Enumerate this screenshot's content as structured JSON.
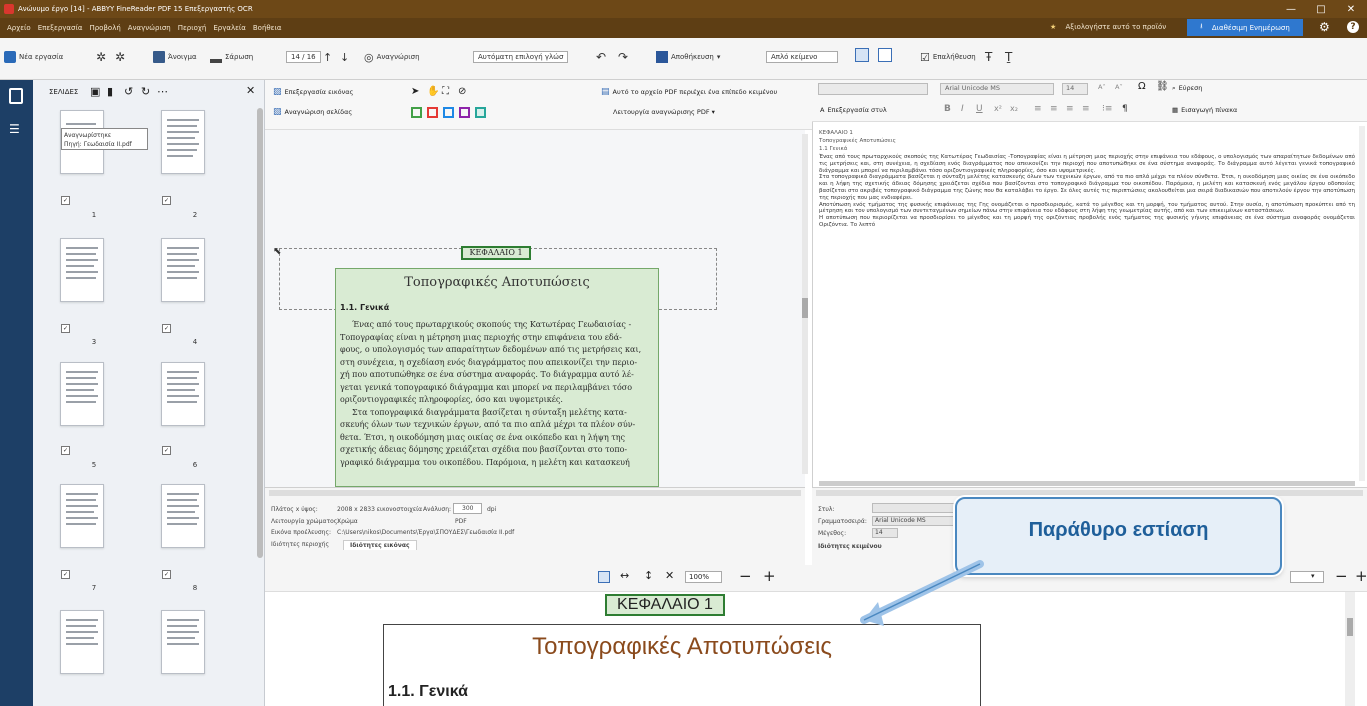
{
  "window": {
    "title": "Ανώνυμο έργο [14] - ABBYY FineReader PDF 15 Επεξεργαστής OCR"
  },
  "menu": [
    "Αρχείο",
    "Επεξεργασία",
    "Προβολή",
    "Αναγνώριση",
    "Περιοχή",
    "Εργαλεία",
    "Βοήθεια"
  ],
  "header_right": {
    "rate": "Αξιολογήστε αυτό το προϊόν",
    "update": "Διαθέσιμη Ενημέρωση"
  },
  "toolbar": {
    "new_task": "Νέα εργασία",
    "open": "Άνοιγμα",
    "save": "Σάρωση",
    "page_counter": "14 / 16",
    "recognize": "Αναγνώριση",
    "lang_select": "Αυτόματη επιλογή γλώσ",
    "save_as": "Αποθήκευση",
    "format_select": "Απλό κείμενο",
    "verify": "Επαλήθευση"
  },
  "thumbs": {
    "title": "ΣΕΛΙΔΕΣ",
    "tooltip_line1": "Αναγνωρίστηκε",
    "tooltip_line2": "Πηγή: Γεωδαισία II.pdf",
    "pages": [
      "1",
      "2",
      "3",
      "4",
      "5",
      "6",
      "7",
      "8"
    ]
  },
  "image_toolbar": {
    "edit_image": "Επεξεργασία εικόνας",
    "recognize_page": "Αναγνώριση σελίδας",
    "pdf_layer": "Αυτό το αρχείο PDF περιέχει ένα επίπεδο κειμένου",
    "pdf_mode": "Λειτουργία αναγνώρισης PDF ▾"
  },
  "pdf": {
    "chapter": "ΚΕΦΑΛΑΙΟ 1",
    "title": "Τοπογραφικές Αποτυπώσεις",
    "section": "1.1. Γενικά",
    "lines": [
      "Ένας από τους πρωταρχικούς σκοπούς της Κατωτέρας Γεωδαισίας -",
      "Τοπογραφίας είναι η μέτρηση μιας περιοχής στην επιφάνεια του εδά-",
      "φους, ο υπολογισμός των απαραίτητων δεδομένων από τις μετρήσεις και,",
      "στη συνέχεια, η σχεδίαση ενός διαγράμματος που απεικονίζει την περιο-",
      "χή που αποτυπώθηκε σε ένα σύστημα αναφοράς. Το διάγραμμα αυτό λέ-",
      "γεται γενικά τοπογραφικό διάγραμμα και μπορεί να περιλαμβάνει τόσο",
      "οριζοντιογραφικές πληροφορίες, όσο και υψομετρικές.",
      "Στα τοπογραφικά διαγράμματα βασίζεται η σύνταξη μελέτης κατα-",
      "σκευής όλων των τεχνικών έργων, από τα πιο απλά μέχρι τα πλέον σύν-",
      "θετα. Έτσι, η οικοδόμηση μιας οικίας σε ένα οικόπεδο και η λήψη της",
      "σχετικής άδειας δόμησης χρειάζεται σχέδια που βασίζονται στο τοπο-",
      "γραφικό διάγραμμα του οικοπέδου. Παρόμοια, η μελέτη και κατασκευή"
    ]
  },
  "text_toolbar": {
    "font": "Arial Unicode MS",
    "size": "14",
    "edit_styles": "Επεξεργασία στυλ",
    "find": "Εύρεση",
    "insert_table": "Εισαγωγή πίνακα"
  },
  "ocr_text": {
    "chapter": "ΚΕΦΑΛΑΙΟ 1",
    "title": "Τοπογραφικές Αποτυπώσεις",
    "section": "1.1 Γενικά",
    "paras": [
      "Ένας από τους πρωταρχικούς σκοπούς της Κατωτέρας Γεωδαισίας -Τοπογραφίας είναι η μέτρηση μιας περιοχής στην επιφάνεια του εδάφους, ο υπολογισμός των απαραίτητων δεδομένων από τις μετρήσεις και, στη συνέχεια, η σχεδίαση ενός διαγράμματος που απεικονίζει την περιοχή που αποτυπώθηκε σε ένα σύστημα αναφοράς. Το διάγραμμα αυτό λέγεται γενικά τοπογραφικό διάγραμμα και μπορεί να περιλαμβάνει τόσο οριζοντιογραφικές πληροφορίες, όσο και υψομετρικές.",
      "Στα τοπογραφικά διαγράμματα βασίζεται η σύνταξη μελέτης κατασκευής όλων των τεχνικών έργων, από τα πιο απλά μέχρι τα πλέον σύνθετα. Έτσι, η οικοδόμηση μιας οικίας σε ένα οικόπεδο και η λήψη της σχετικής άδειας δόμησης χρειάζεται σχέδια που βασίζονται στο τοπογραφικό διάγραμμα του οικοπέδου. Παρόμοια, η μελέτη και κατασκευή ενός μεγάλου έργου οδοποιίας βασίζεται στο ακριβές τοπογραφικό διάγραμμα της ζώνης που θα καταλάβει το έργο. Σε όλες αυτές τις περιπτώσεις ακολουθείται μια σειρά διαδικασιών που αποτελούν έργου την αποτύπωση της περιοχής που μας ενδιαφέρει.",
      "Αποτύπωση ενός τμήματος της φυσικής επιφάνειας της Γης ονομάζεται ο προσδιορισμός, κατά το μέγεθος και τη μορφή, του τμήματος αυτού. Στην ουσία, η αποτύπωση προκύπτει από τη μέτρηση και τον υπολογισμό των συντεταγμένων σημείων πάνω στην επιφάνεια του εδάφους στη λήψη της γεωμετρίας αυτής, από και των επικειμένων καταστάσεων.",
      "Η αποτύπωση που περιορίζεται να προσδιορίσει το μέγεθος και τη μορφή της οριζόντιας προβολής ενός τμήματος της φυσικής γήινης επιφάνειας σε ένα σύστημα αναφοράς ονομάζεται Οριζόντια. Το λεπτό"
    ]
  },
  "info": {
    "size_label": "Πλάτος x ύψος:",
    "size_value": "2008 x 2833 εικονοστοιχεία",
    "res_label": "Ανάλυση:",
    "res_value": "300",
    "dpi": "dpi",
    "color_label": "Λειτουργία χρώματος:",
    "color_value": "Χρώμα",
    "fmt_value": "PDF",
    "src_label": "Εικόνα προέλευσης:",
    "src_value": "C:\\Users\\nikos\\Documents\\Έργα\\ΣΠΟΥΔΕΣ\\Γεωδαισία II.pdf",
    "tab1": "Ιδιότητες περιοχής",
    "tab2": "Ιδιότητες εικόνας"
  },
  "props": {
    "style_label": "Στυλ:",
    "font_label": "Γραμματοσειρά:",
    "font_value": "Arial Unicode MS",
    "size_label": "Μέγεθος:",
    "size_value": "14",
    "tab": "Ιδιότητες κειμένου"
  },
  "zoom": {
    "value": "100%",
    "minus": "−",
    "plus": "+"
  },
  "callout": {
    "text": "Παράθυρο εστίαση"
  },
  "zoomwin": {
    "chapter": "ΚΕΦΑΛΑΙΟ 1",
    "title": "Τοπογραφικές Αποτυπώσεις",
    "section": "1.1. Γενικά"
  }
}
